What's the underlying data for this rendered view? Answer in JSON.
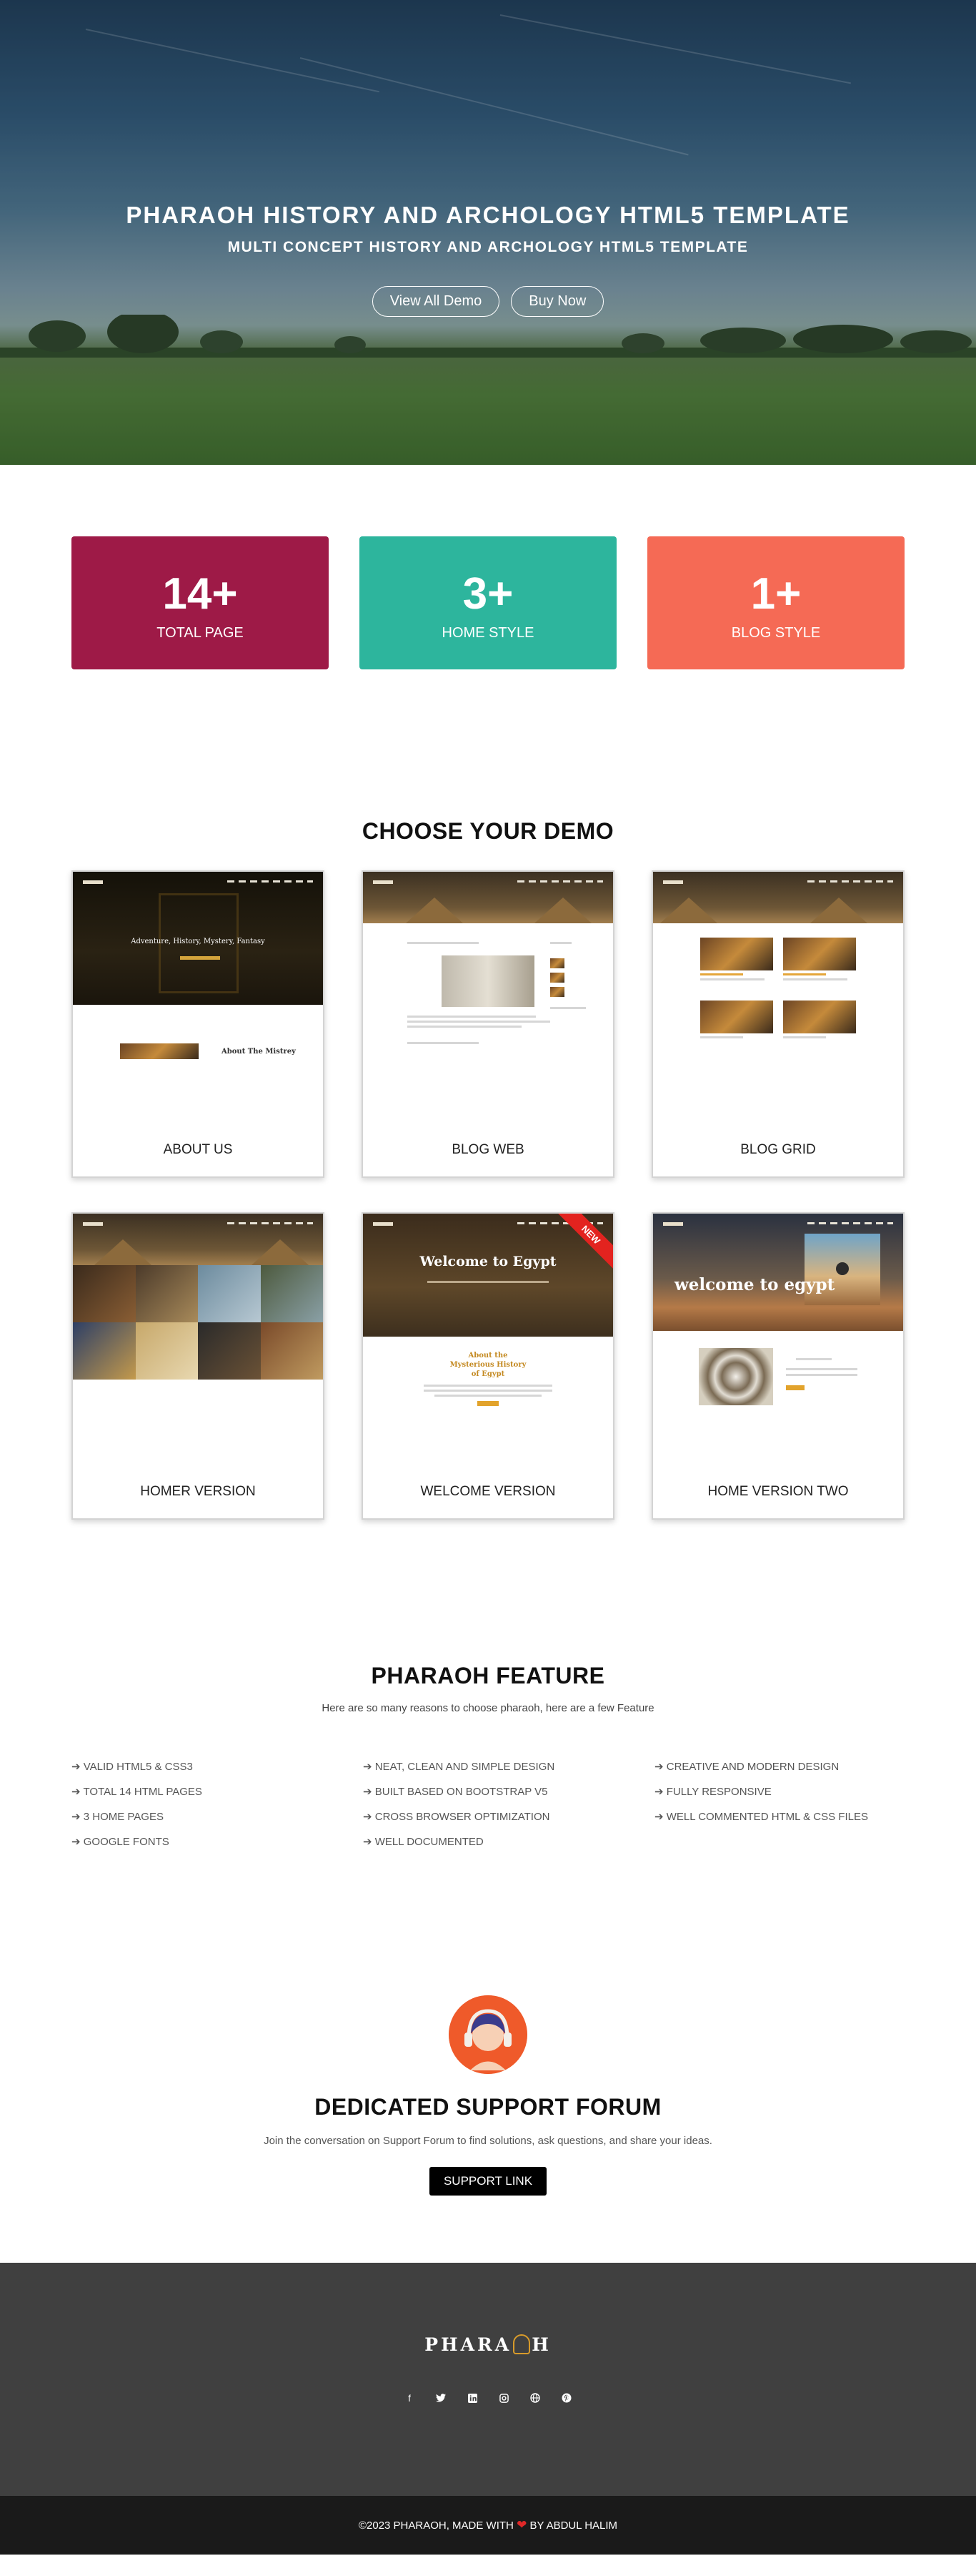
{
  "hero": {
    "title": "PHARAOH HISTORY AND ARCHOLOGY HTML5 TEMPLATE",
    "subtitle": "MULTI CONCEPT HISTORY AND ARCHOLOGY HTML5 TEMPLATE",
    "buttons": [
      {
        "label": "View All Demo"
      },
      {
        "label": "Buy Now"
      }
    ]
  },
  "stats": [
    {
      "number": "14+",
      "label": "TOTAL PAGE",
      "color": "#9e1a47"
    },
    {
      "number": "3+",
      "label": "HOME STYLE",
      "color": "#2db59d"
    },
    {
      "number": "1+",
      "label": "BLOG STYLE",
      "color": "#f56a55"
    }
  ],
  "demos": {
    "title": "CHOOSE YOUR DEMO",
    "items": [
      {
        "label": "ABOUT US",
        "shot": {
          "hero_text": "Adventure, History, Mystery, Fantasy",
          "section_text": "About The Mistrey"
        }
      },
      {
        "label": "BLOG WEB"
      },
      {
        "label": "BLOG GRID"
      },
      {
        "label": "HOMER VERSION"
      },
      {
        "label": "WELCOME VERSION",
        "badge": "NEW",
        "shot": {
          "hero_text": "Welcome to Egypt",
          "section_text": "About the Mysterious History of Egypt"
        }
      },
      {
        "label": "HOME VERSION TWO",
        "shot": {
          "hero_text": "welcome to egypt"
        }
      }
    ]
  },
  "feature": {
    "title": "PHARAOH FEATURE",
    "subtitle": "Here are so many reasons to choose pharaoh, here are a few Feature",
    "items": [
      "➔ VALID HTML5 & CSS3",
      "➔ NEAT, CLEAN AND SIMPLE DESIGN",
      "➔ CREATIVE AND MODERN DESIGN",
      "➔ TOTAL 14 HTML PAGES",
      "➔ BUILT BASED ON BOOTSTRAP V5",
      "➔ FULLY RESPONSIVE",
      "➔ 3 HOME PAGES",
      "➔ CROSS BROWSER OPTIMIZATION",
      "➔ WELL COMMENTED HTML & CSS FILES",
      "➔ GOOGLE FONTS",
      "➔ WELL DOCUMENTED"
    ]
  },
  "support": {
    "title": "DEDICATED SUPPORT FORUM",
    "text": "Join the conversation on Support Forum to find solutions, ask questions, and share your ideas.",
    "button": "SUPPORT LINK"
  },
  "footer": {
    "logo_left": "PHARA",
    "logo_right": "H",
    "social_icons": [
      "facebook-icon",
      "twitter-icon",
      "linkedin-icon",
      "instagram-icon",
      "globe-icon",
      "pinterest-icon"
    ],
    "copyright_before": "©2023 PHARAOH, MADE WITH",
    "heart": "❤",
    "copyright_after": "BY ABDUL HALIM"
  }
}
